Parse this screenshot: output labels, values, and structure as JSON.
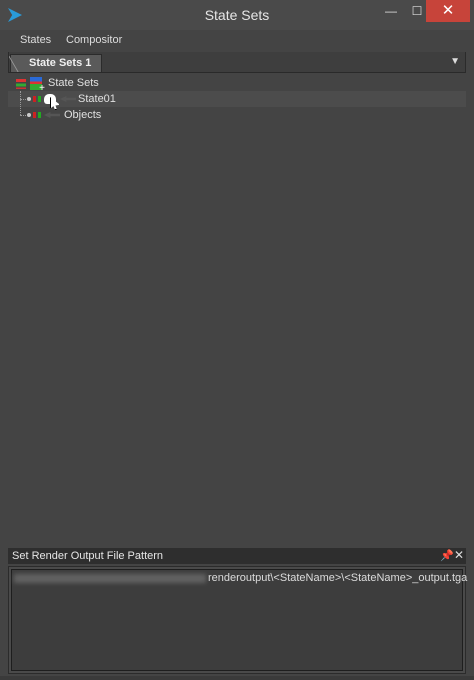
{
  "window": {
    "title": "State Sets",
    "minimize": "—",
    "maximize": "☐",
    "close": "✕"
  },
  "menu": {
    "items": [
      "States",
      "Compositor"
    ]
  },
  "tabs": {
    "active": "State Sets 1",
    "dropdown": "▼"
  },
  "tree": {
    "root_label": "State Sets",
    "state_label": "State01",
    "objects_label": "Objects"
  },
  "output_panel": {
    "title": "Set Render Output File Pattern",
    "pin": "📌",
    "close": "✕",
    "pattern": "renderoutput\\<StateName>\\<StateName>_output.tga"
  },
  "colors": {
    "accent_close": "#c7443a",
    "app_icon": "#2a9bd8"
  },
  "icons": [
    "app-icon",
    "minimize-icon",
    "maximize-icon",
    "close-icon",
    "dropdown-icon",
    "state-sets-icon",
    "state-icon",
    "teapot-icon",
    "cursor-icon",
    "pin-icon",
    "panel-close-icon"
  ]
}
